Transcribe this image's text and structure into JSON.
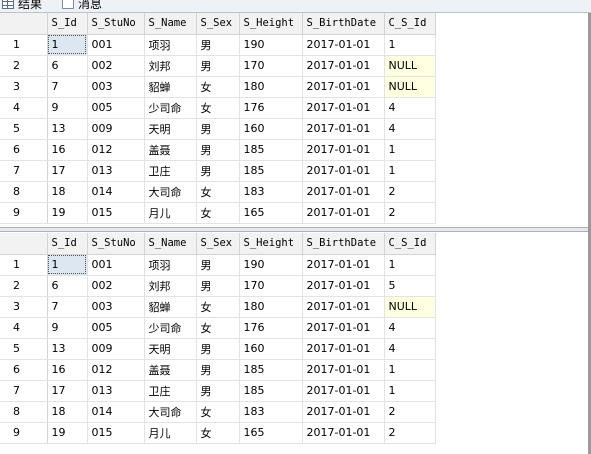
{
  "tabs": [
    {
      "label": "结果",
      "icon": "grid-icon"
    },
    {
      "label": "消息",
      "icon": "message-icon"
    }
  ],
  "columns": [
    "S_Id",
    "S_StuNo",
    "S_Name",
    "S_Sex",
    "S_Height",
    "S_BirthDate",
    "C_S_Id"
  ],
  "result1": {
    "rows": [
      [
        "1",
        "1",
        "001",
        "项羽",
        "男",
        "190",
        "2017-01-01",
        "1"
      ],
      [
        "2",
        "6",
        "002",
        "刘邦",
        "男",
        "170",
        "2017-01-01",
        "NULL"
      ],
      [
        "3",
        "7",
        "003",
        "貂蝉",
        "女",
        "180",
        "2017-01-01",
        "NULL"
      ],
      [
        "4",
        "9",
        "005",
        "少司命",
        "女",
        "176",
        "2017-01-01",
        "4"
      ],
      [
        "5",
        "13",
        "009",
        "天明",
        "男",
        "160",
        "2017-01-01",
        "4"
      ],
      [
        "6",
        "16",
        "012",
        "盖聂",
        "男",
        "185",
        "2017-01-01",
        "1"
      ],
      [
        "7",
        "17",
        "013",
        "卫庄",
        "男",
        "185",
        "2017-01-01",
        "1"
      ],
      [
        "8",
        "18",
        "014",
        "大司命",
        "女",
        "183",
        "2017-01-01",
        "2"
      ],
      [
        "9",
        "19",
        "015",
        "月儿",
        "女",
        "165",
        "2017-01-01",
        "2"
      ]
    ]
  },
  "result2": {
    "rows": [
      [
        "1",
        "1",
        "001",
        "项羽",
        "男",
        "190",
        "2017-01-01",
        "1"
      ],
      [
        "2",
        "6",
        "002",
        "刘邦",
        "男",
        "170",
        "2017-01-01",
        "5"
      ],
      [
        "3",
        "7",
        "003",
        "貂蝉",
        "女",
        "180",
        "2017-01-01",
        "NULL"
      ],
      [
        "4",
        "9",
        "005",
        "少司命",
        "女",
        "176",
        "2017-01-01",
        "4"
      ],
      [
        "5",
        "13",
        "009",
        "天明",
        "男",
        "160",
        "2017-01-01",
        "4"
      ],
      [
        "6",
        "16",
        "012",
        "盖聂",
        "男",
        "185",
        "2017-01-01",
        "1"
      ],
      [
        "7",
        "17",
        "013",
        "卫庄",
        "男",
        "185",
        "2017-01-01",
        "1"
      ],
      [
        "8",
        "18",
        "014",
        "大司命",
        "女",
        "183",
        "2017-01-01",
        "2"
      ],
      [
        "9",
        "19",
        "015",
        "月儿",
        "女",
        "165",
        "2017-01-01",
        "2"
      ]
    ]
  },
  "colors": {
    "null_bg": "#ffffe1",
    "selected_bg": "#dde7f1",
    "header_bg": "#f2f2f2"
  }
}
